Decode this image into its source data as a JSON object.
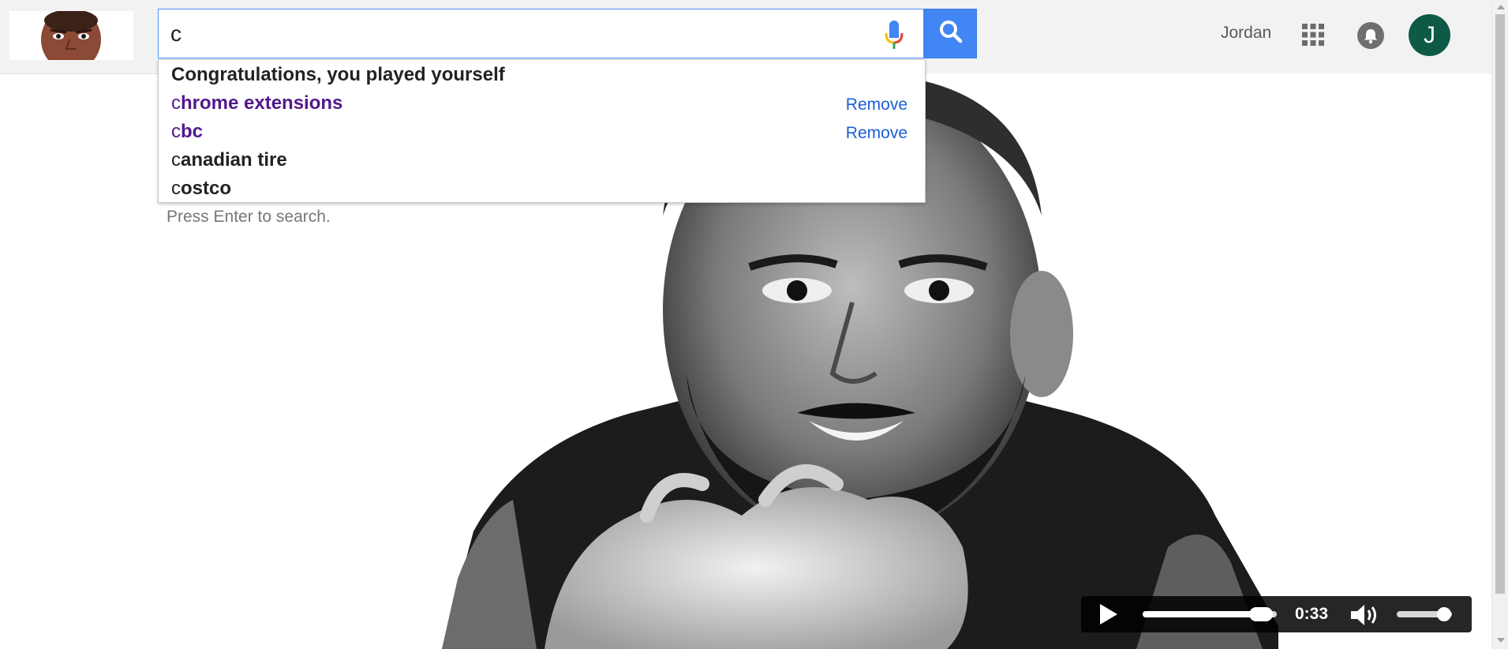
{
  "user": {
    "name": "Jordan",
    "avatar_initial": "J"
  },
  "search": {
    "value": "c",
    "suggestions": [
      {
        "prefix": "",
        "rest": "Congratulations, you played yourself",
        "visited": false,
        "remove_label": ""
      },
      {
        "prefix": "c",
        "rest": "hrome extensions",
        "visited": true,
        "remove_label": "Remove"
      },
      {
        "prefix": "c",
        "rest": "bc",
        "visited": true,
        "remove_label": "Remove"
      },
      {
        "prefix": "c",
        "rest": "anadian tire",
        "visited": false,
        "remove_label": ""
      },
      {
        "prefix": "c",
        "rest": "ostco",
        "visited": false,
        "remove_label": ""
      }
    ],
    "hint": "Press Enter to search."
  },
  "video": {
    "time": "0:33",
    "progress": 0.88,
    "volume": 0.85
  },
  "colors": {
    "accent": "#4285f4",
    "visited_link": "#52188c",
    "remove_link": "#1a5fd6",
    "avatar_bg": "#0e5a46"
  },
  "icons": {
    "mic": "mic-icon",
    "search": "search-icon",
    "apps": "apps-grid-icon",
    "notifications": "bell-icon",
    "play": "play-icon",
    "volume": "volume-icon"
  }
}
